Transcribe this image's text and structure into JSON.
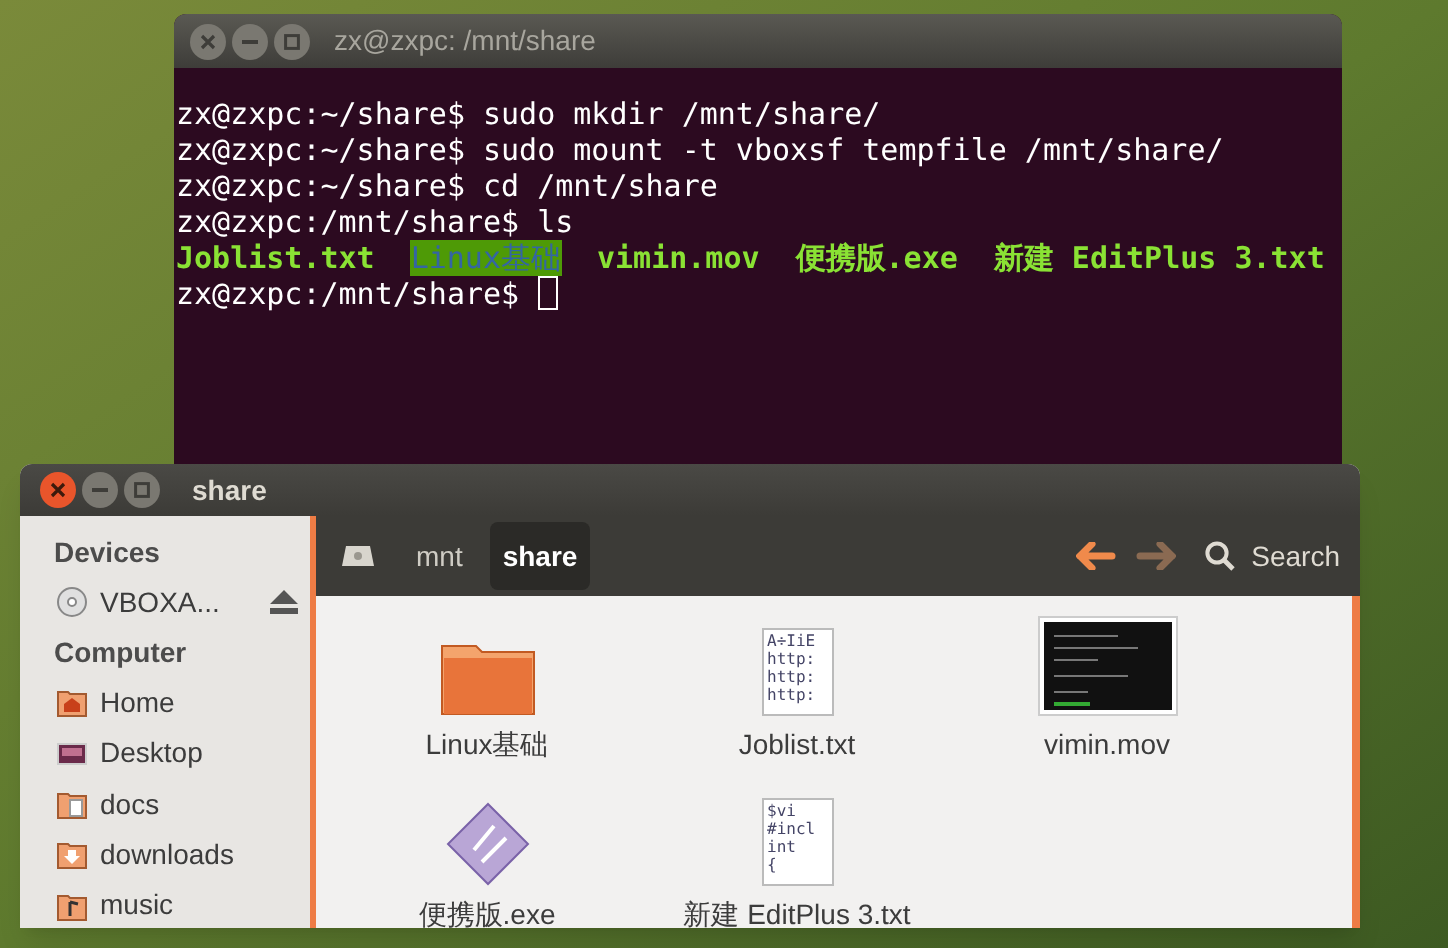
{
  "terminal": {
    "title": "zx@zxpc: /mnt/share",
    "focused": false,
    "lines": [
      {
        "kind": "command",
        "prompt": "zx@zxpc:~/share$",
        "command": "sudo mkdir /mnt/share/"
      },
      {
        "kind": "command",
        "prompt": "zx@zxpc:~/share$",
        "command": "sudo mount -t vboxsf tempfile /mnt/share/"
      },
      {
        "kind": "command",
        "prompt": "zx@zxpc:~/share$",
        "command": "cd /mnt/share"
      },
      {
        "kind": "command",
        "prompt": "zx@zxpc:/mnt/share$",
        "command": "ls"
      },
      {
        "kind": "listing",
        "entries": [
          {
            "name": "Joblist.txt",
            "kind": "file"
          },
          {
            "name": "Linux基础",
            "kind": "dir"
          },
          {
            "name": "vimin.mov",
            "kind": "file"
          },
          {
            "name": "便携版.exe",
            "kind": "file"
          },
          {
            "name": "新建 EditPlus 3.txt",
            "kind": "file"
          }
        ]
      },
      {
        "kind": "input",
        "prompt": "zx@zxpc:/mnt/share$"
      }
    ]
  },
  "file_manager": {
    "title": "share",
    "focused": true,
    "breadcrumbs": [
      {
        "kind": "drive",
        "selected": false
      },
      {
        "kind": "folder",
        "label": "mnt",
        "selected": false
      },
      {
        "kind": "folder",
        "label": "share",
        "selected": true
      }
    ],
    "back": {
      "disabled": false
    },
    "forward": {
      "disabled": true
    },
    "search": {
      "label": "Search"
    },
    "sidebar": [
      {
        "heading": "Devices",
        "items": [
          {
            "label": "VBOXA...",
            "kind": "disc",
            "eject": true
          }
        ]
      },
      {
        "heading": "Computer",
        "items": [
          {
            "label": "Home",
            "kind": "home",
            "eject": false
          },
          {
            "label": "Desktop",
            "kind": "desktop",
            "eject": false
          },
          {
            "label": "docs",
            "kind": "docs",
            "eject": false
          },
          {
            "label": "downloads",
            "kind": "downloads",
            "eject": false
          },
          {
            "label": "music",
            "kind": "music",
            "eject": false
          }
        ]
      }
    ],
    "files": [
      {
        "name": "Linux基础",
        "kind": "folder"
      },
      {
        "name": "Joblist.txt",
        "kind": "text",
        "preview": [
          "A÷IiE",
          "http:",
          "http:",
          "http:"
        ]
      },
      {
        "name": "vimin.mov",
        "kind": "video"
      },
      {
        "name": "便携版.exe",
        "kind": "exe"
      },
      {
        "name": "新建 EditPlus 3.txt",
        "kind": "text",
        "preview": [
          "$vi",
          "#incl",
          "int",
          "{"
        ]
      }
    ]
  }
}
